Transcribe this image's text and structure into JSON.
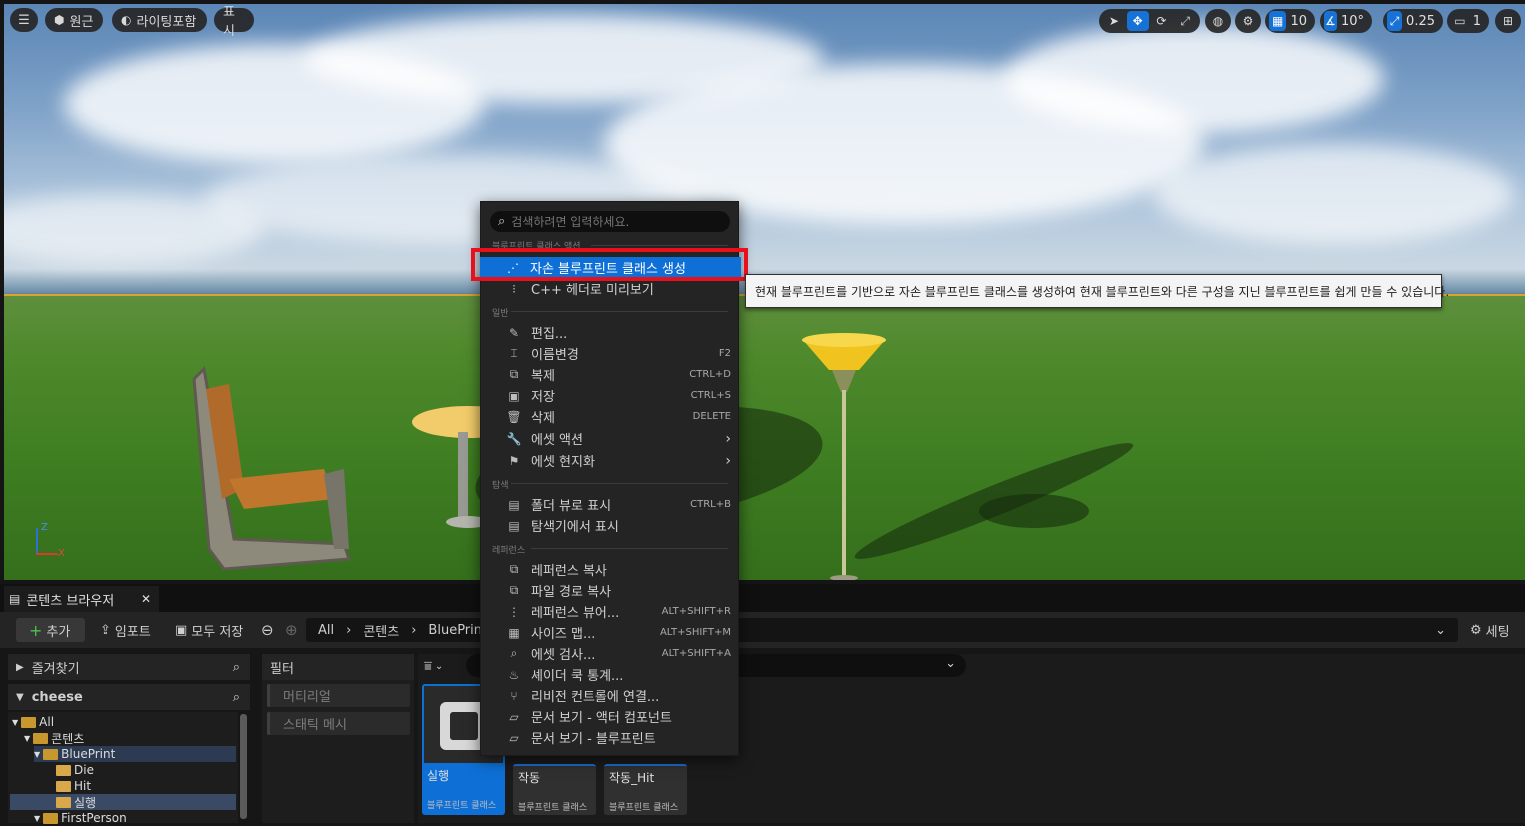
{
  "viewport": {
    "menu_icon": "hamburger-icon",
    "perspective_label": "원근",
    "lighting_label": "라이팅포함",
    "show_label": "표시",
    "grid_snap_value": "10",
    "rotation_snap_value": "10°",
    "scale_snap_value": "0.25",
    "camera_speed_value": "1",
    "axis_z": "Z",
    "axis_x": "X"
  },
  "context_menu": {
    "search_placeholder": "검색하려면 입력하세요.",
    "section_blueprint": "블루프린트 클래스 액션",
    "section_general": "일반",
    "section_explore": "탐색",
    "section_reference": "레퍼런스",
    "items": [
      {
        "label": "자손 블루프린트 클래스 생성",
        "shortcut": "",
        "icon": "child-blueprint-icon"
      },
      {
        "label": "C++ 헤더로 미리보기",
        "shortcut": "",
        "icon": "cpp-header-icon"
      },
      {
        "label": "편집...",
        "shortcut": "",
        "icon": "pencil-icon"
      },
      {
        "label": "이름변경",
        "shortcut": "F2",
        "icon": "rename-icon"
      },
      {
        "label": "복제",
        "shortcut": "CTRL+D",
        "icon": "duplicate-icon"
      },
      {
        "label": "저장",
        "shortcut": "CTRL+S",
        "icon": "save-icon"
      },
      {
        "label": "삭제",
        "shortcut": "DELETE",
        "icon": "trash-icon"
      },
      {
        "label": "에셋 액션",
        "shortcut": "",
        "icon": "wrench-icon"
      },
      {
        "label": "에셋 현지화",
        "shortcut": "",
        "icon": "flag-icon"
      },
      {
        "label": "폴더 뷰로 표시",
        "shortcut": "CTRL+B",
        "icon": "folder-search-icon"
      },
      {
        "label": "탐색기에서 표시",
        "shortcut": "",
        "icon": "explorer-icon"
      },
      {
        "label": "레퍼런스 복사",
        "shortcut": "",
        "icon": "copy-reference-icon"
      },
      {
        "label": "파일 경로 복사",
        "shortcut": "",
        "icon": "copy-path-icon"
      },
      {
        "label": "레퍼런스 뷰어...",
        "shortcut": "ALT+SHIFT+R",
        "icon": "reference-viewer-icon"
      },
      {
        "label": "사이즈 맵...",
        "shortcut": "ALT+SHIFT+M",
        "icon": "size-map-icon"
      },
      {
        "label": "에셋 검사...",
        "shortcut": "ALT+SHIFT+A",
        "icon": "asset-audit-icon"
      },
      {
        "label": "셰이더 쿡 통계...",
        "shortcut": "",
        "icon": "shader-icon"
      },
      {
        "label": "리비전 컨트롤에 연결...",
        "shortcut": "",
        "icon": "revision-control-icon"
      },
      {
        "label": "문서 보기 - 액터 컴포넌트",
        "shortcut": "",
        "icon": "document-icon"
      },
      {
        "label": "문서 보기 - 블루프린트",
        "shortcut": "",
        "icon": "document-icon"
      }
    ],
    "tooltip": "현재 블루프린트를 기반으로 자손 블루프린트 클래스를 생성하여 현재 블루프린트와 다른 구성을 지닌 블루프린트를 쉽게 만들 수 있습니다."
  },
  "content_browser": {
    "tab_title": "콘텐츠 브라우저",
    "add_label": "추가",
    "import_label": "임포트",
    "save_all_label": "모두 저장",
    "path": [
      "All",
      "콘텐츠",
      "BluePrint"
    ],
    "settings_label": "세팅",
    "favorites_label": "즐겨찾기",
    "project_label": "cheese",
    "filter_label": "필터",
    "filters": [
      "머티리얼",
      "스태틱 메시"
    ],
    "tree": [
      "All",
      "콘텐츠",
      "BluePrint",
      "Die",
      "Hit",
      "실행",
      "FirstPerson"
    ],
    "assets": [
      {
        "name": "실행",
        "type": "블루프린트 클래스"
      },
      {
        "name": "작동",
        "type": "블루프린트 클래스"
      },
      {
        "name": "작동_Hit",
        "type": "블루프린트 클래스"
      }
    ]
  },
  "colors": {
    "accent": "#0e70d6",
    "highlight_box": "#e8101c",
    "selection_outline": "#d9a32f"
  }
}
